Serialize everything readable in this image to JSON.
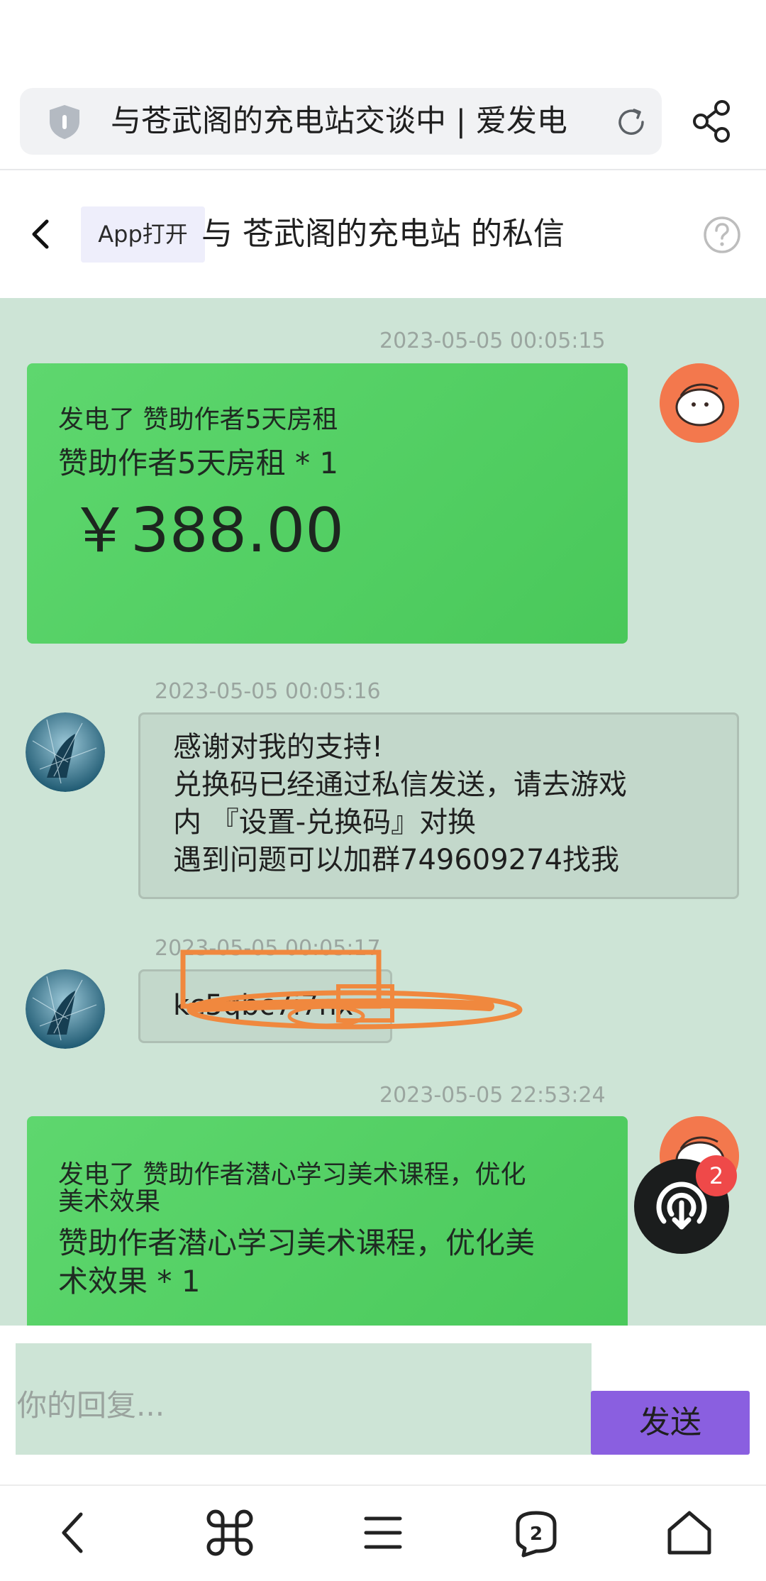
{
  "browser": {
    "url_title": "与苍武阁的充电站交谈中 | 爱发电",
    "icons": {
      "security": "shield-icon",
      "reload": "reload-icon",
      "share": "share-icon"
    }
  },
  "header": {
    "app_open_label": "App打开",
    "title": "与 苍武阁的充电站 的私信",
    "icons": {
      "back": "chevron-left-icon",
      "help": "question-circle-icon"
    }
  },
  "messages": [
    {
      "side": "right",
      "type": "sponsor",
      "timestamp": "2023-05-05 00:05:15",
      "line1": "发电了 赞助作者5天房租",
      "line2": "赞助作者5天房租 * 1",
      "price": "￥388.00"
    },
    {
      "side": "left",
      "type": "text",
      "timestamp": "2023-05-05 00:05:16",
      "lines": [
        "感谢对我的支持!",
        "兑换码已经通过私信发送，请去游戏",
        "内 『设置-兑换码』对换",
        "遇到问题可以加群749609274找我"
      ]
    },
    {
      "side": "left",
      "type": "text",
      "timestamp": "2023-05-05 00:05:17",
      "text": "kc5qbc7i7nx"
    },
    {
      "side": "right",
      "type": "sponsor",
      "timestamp": "2023-05-05 22:53:24",
      "line1": "发电了 赞助作者潜心学习美术课程，优化美术效果",
      "line1a": "发电了 赞助作者潜心学习美术课程，优化",
      "line1b": "美术效果",
      "line2a": "赞助作者潜心学习美术课程，优化美",
      "line2b": "术效果 * 1"
    }
  ],
  "fab": {
    "badge": "2",
    "icon": "broadcast-download-icon"
  },
  "composer": {
    "placeholder": "你的回复...",
    "send_label": "发送"
  },
  "bottom_nav": {
    "items": [
      "back-icon",
      "command-icon",
      "menu-icon",
      "tabs-icon",
      "home-icon"
    ],
    "tabs_count": "2"
  },
  "colors": {
    "chat_bg": "#cde4d6",
    "sponsor_card": "#4fcd60",
    "send_button": "#8a5fe0",
    "badge": "#ef4949",
    "annotation": "#f0883e"
  }
}
